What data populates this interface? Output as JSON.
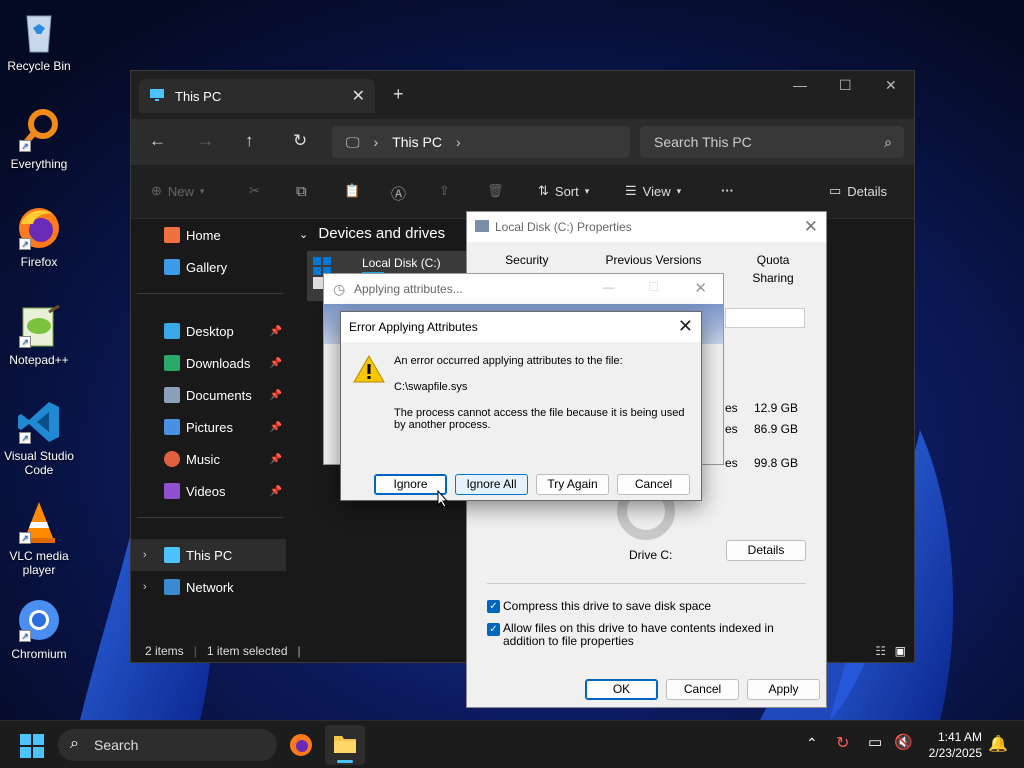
{
  "desktop": {
    "icons": [
      {
        "label": "Recycle Bin"
      },
      {
        "label": "Everything"
      },
      {
        "label": "Firefox"
      },
      {
        "label": "Notepad++"
      },
      {
        "label": "Visual Studio Code"
      },
      {
        "label": "VLC media player"
      },
      {
        "label": "Chromium"
      }
    ]
  },
  "explorer": {
    "tab_title": "This PC",
    "address": "This PC",
    "search_placeholder": "Search This PC",
    "toolbar": {
      "new_label": "New",
      "sort_label": "Sort",
      "view_label": "View",
      "more_label": "···",
      "details_label": "Details"
    },
    "nav": {
      "home": "Home",
      "gallery": "Gallery",
      "desktop": "Desktop",
      "downloads": "Downloads",
      "documents": "Documents",
      "pictures": "Pictures",
      "music": "Music",
      "videos": "Videos",
      "this_pc": "This PC",
      "network": "Network"
    },
    "group_header": "Devices and drives",
    "drive_name": "Local Disk (C:)",
    "status": {
      "items": "2 items",
      "selected": "1 item selected"
    }
  },
  "properties": {
    "title": "Local Disk (C:) Properties",
    "tabs_row1": [
      "Security",
      "Previous Versions",
      "Quota"
    ],
    "tabs_row2_right": "Sharing",
    "sizes": [
      "12.9 GB",
      "86.9 GB",
      "99.8 GB"
    ],
    "size_suffix": "es",
    "drive_label": "Drive C:",
    "details_button": "Details",
    "compress_label": "Compress this drive to save disk space",
    "index_label": "Allow files on this drive to have contents indexed in addition to file properties",
    "ok": "OK",
    "cancel": "Cancel",
    "apply": "Apply"
  },
  "applying": {
    "title": "Applying attributes..."
  },
  "error_dialog": {
    "title": "Error Applying Attributes",
    "message": "An error occurred applying attributes to the file:",
    "file": "C:\\swapfile.sys",
    "reason": "The process cannot access the file because it is being used by another process.",
    "buttons": {
      "ignore": "Ignore",
      "ignore_all": "Ignore All",
      "try_again": "Try Again",
      "cancel": "Cancel"
    }
  },
  "taskbar": {
    "search_label": "Search",
    "time": "1:41 AM",
    "date": "2/23/2025"
  },
  "colors": {
    "accent": "#0067c0",
    "explorer_bg": "#191919",
    "dialog_bg": "#f0f0f0",
    "taskbar_bg": "#1c1c1c"
  }
}
